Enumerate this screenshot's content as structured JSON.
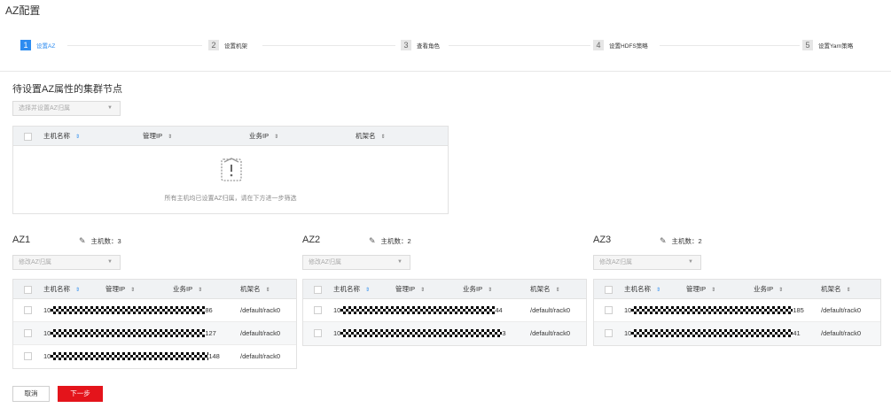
{
  "page_title": "AZ配置",
  "steps": [
    {
      "num": "1",
      "label": "设置AZ",
      "active": true
    },
    {
      "num": "2",
      "label": "设置机架",
      "active": false
    },
    {
      "num": "3",
      "label": "查看角色",
      "active": false
    },
    {
      "num": "4",
      "label": "设置HDFS策略",
      "active": false
    },
    {
      "num": "5",
      "label": "设置Yarn策略",
      "active": false
    }
  ],
  "pending": {
    "title": "待设置AZ属性的集群节点",
    "select_placeholder": "选择并设置AZ归属",
    "columns": [
      "主机名称",
      "管理IP",
      "业务IP",
      "机架名"
    ],
    "empty_text": "所有主机均已设置AZ归属，请在下方进一步筛选"
  },
  "az_panels": [
    {
      "name": "AZ1",
      "count_label": "主机数：",
      "count": "3",
      "select_placeholder": "修改AZ归属",
      "columns": [
        "主机名称",
        "管理IP",
        "业务IP",
        "机架名"
      ],
      "rows": [
        {
          "host_prefix": "10",
          "host_suffix": "86",
          "rack": "/default/rack0"
        },
        {
          "host_prefix": "10",
          "host_suffix": "127",
          "rack": "/default/rack0"
        },
        {
          "host_prefix": "10",
          "host_suffix": "148",
          "rack": "/default/rack0"
        }
      ]
    },
    {
      "name": "AZ2",
      "count_label": "主机数：",
      "count": "2",
      "select_placeholder": "修改AZ归属",
      "columns": [
        "主机名称",
        "管理IP",
        "业务IP",
        "机架名"
      ],
      "rows": [
        {
          "host_prefix": "10",
          "host_suffix": "44",
          "rack": "/default/rack0"
        },
        {
          "host_prefix": "10",
          "host_suffix": "3",
          "rack": "/default/rack0"
        }
      ]
    },
    {
      "name": "AZ3",
      "count_label": "主机数：",
      "count": "2",
      "select_placeholder": "修改AZ归属",
      "columns": [
        "主机名称",
        "管理IP",
        "业务IP",
        "机架名"
      ],
      "rows": [
        {
          "host_prefix": "10",
          "host_suffix": "185",
          "rack": "/default/rack0"
        },
        {
          "host_prefix": "10",
          "host_suffix": "41",
          "rack": "/default/rack0"
        }
      ]
    }
  ],
  "buttons": {
    "cancel": "取消",
    "next": "下一步"
  },
  "colors": {
    "accent": "#2d8cf0",
    "primary_button": "#e4141b"
  }
}
